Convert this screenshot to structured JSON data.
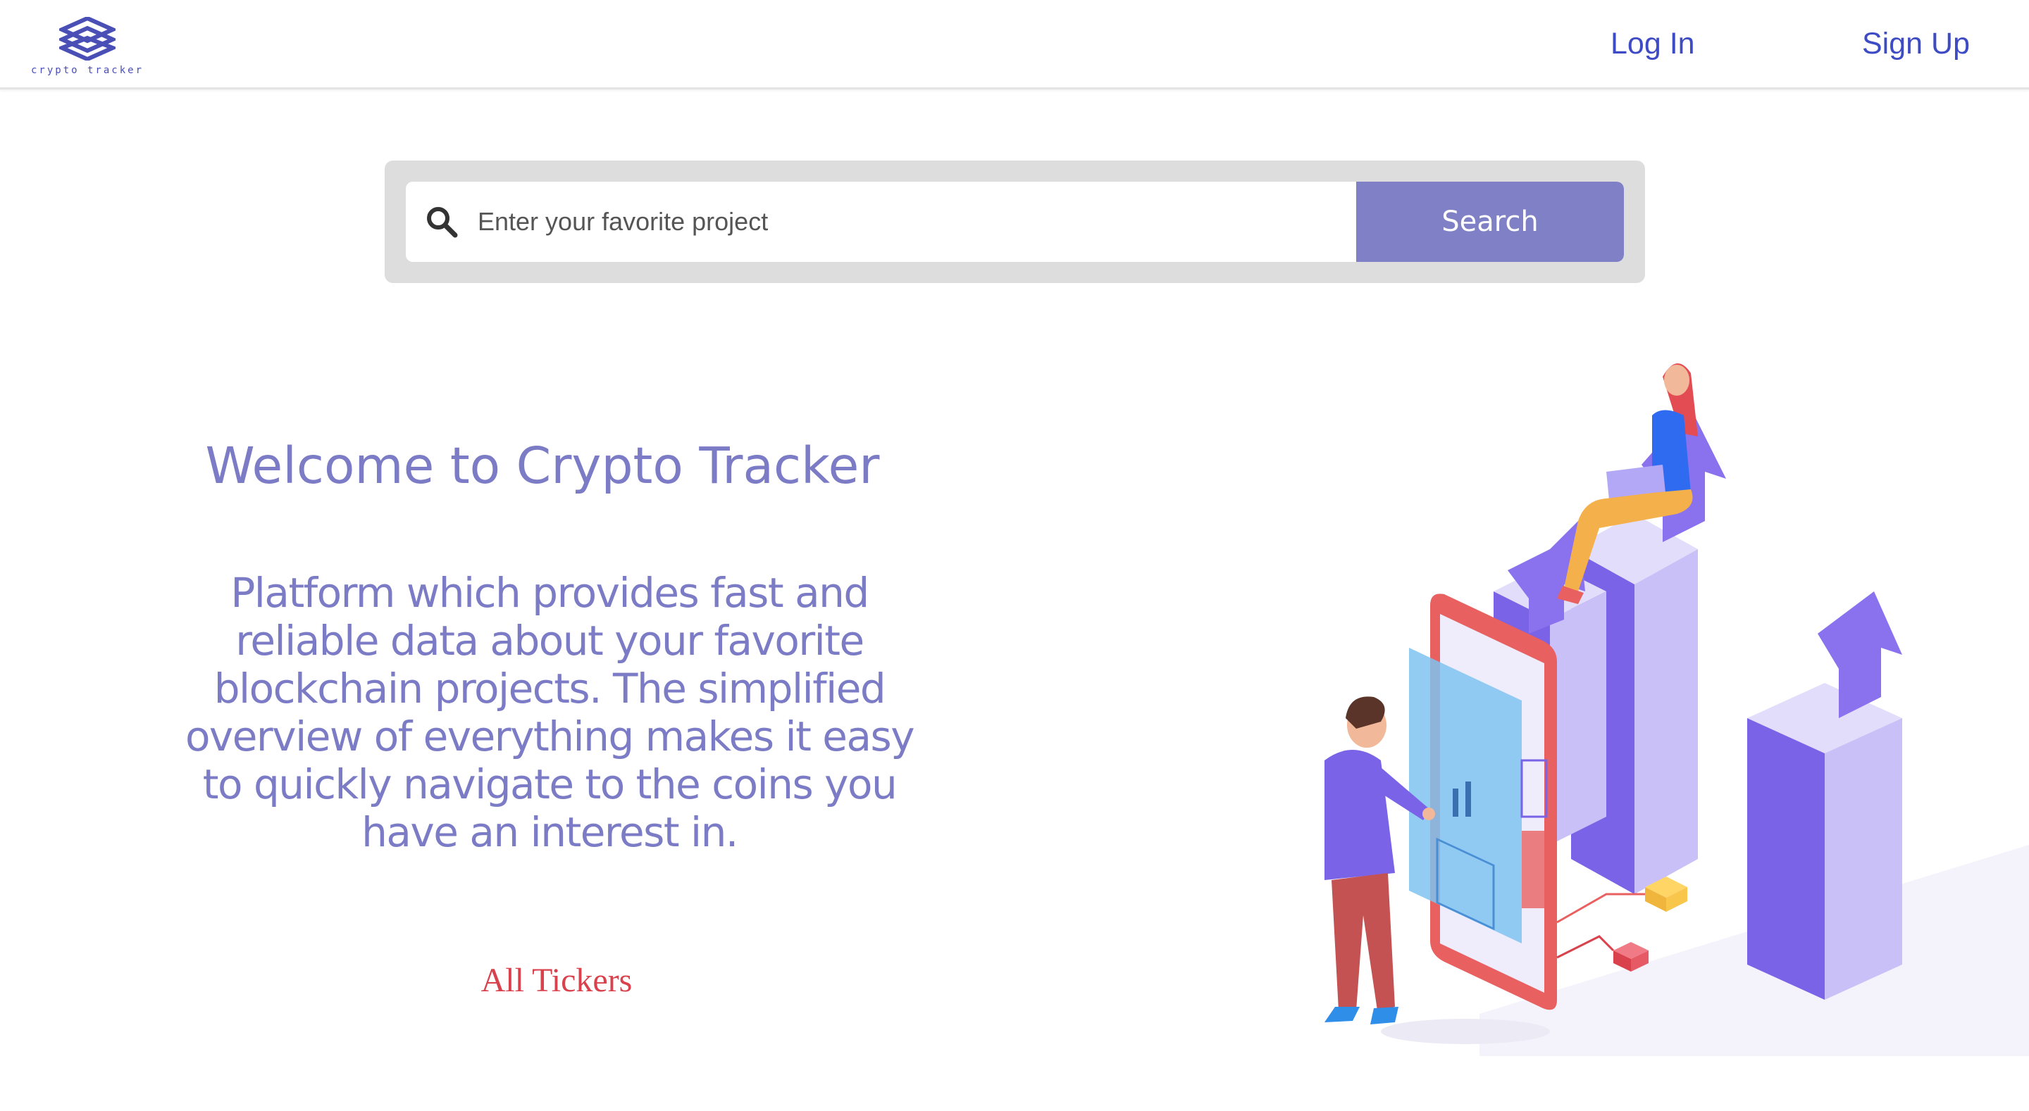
{
  "header": {
    "logo_text": "crypto tracker",
    "login_label": "Log In",
    "signup_label": "Sign Up"
  },
  "search": {
    "placeholder": "Enter your favorite project",
    "button_label": "Search"
  },
  "hero": {
    "title": "Welcome to Crypto Tracker",
    "description": "Platform which provides fast and reliable data about your favorite blockchain projects. The simplified overview of everything makes it easy to quickly navigate to the coins you have an interest in.",
    "all_tickers_label": "All Tickers"
  },
  "colors": {
    "accent": "#7b7bc6",
    "search_button": "#8080c6",
    "nav_link": "#3d4bc4",
    "all_tickers": "#d9424c"
  }
}
